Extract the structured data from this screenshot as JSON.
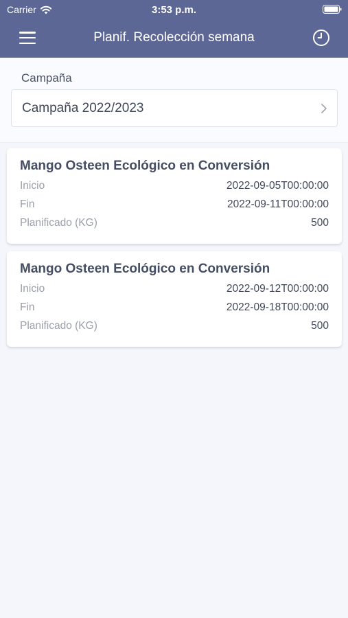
{
  "status_bar": {
    "carrier": "Carrier",
    "time": "3:53 p.m."
  },
  "nav": {
    "title": "Planif. Recolección semana",
    "menu_icon": "hamburger-menu-icon",
    "history_icon": "clock-icon"
  },
  "campaign": {
    "label": "Campaña",
    "value": "Campaña 2022/2023"
  },
  "cards": [
    {
      "title": "Mango Osteen Ecológico en Conversión",
      "start_label": "Inicio",
      "start_value": "2022-09-05T00:00:00",
      "end_label": "Fin",
      "end_value": "2022-09-11T00:00:00",
      "planned_label": "Planificado (KG)",
      "planned_value": "500"
    },
    {
      "title": "Mango Osteen Ecológico en Conversión",
      "start_label": "Inicio",
      "start_value": "2022-09-12T00:00:00",
      "end_label": "Fin",
      "end_value": "2022-09-18T00:00:00",
      "planned_label": "Planificado (KG)",
      "planned_value": "500"
    }
  ],
  "colors": {
    "header": "#5c6796",
    "background": "#f5f6fb",
    "card": "#ffffff"
  }
}
